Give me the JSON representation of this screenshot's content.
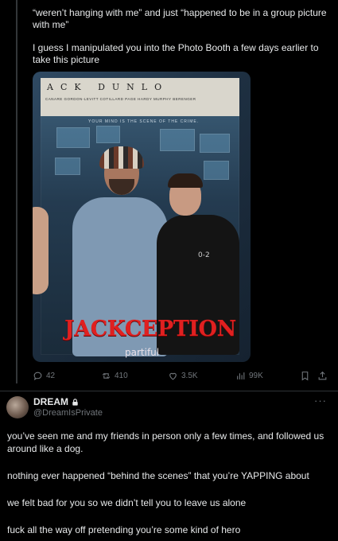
{
  "tweet_top": {
    "paragraph1": "“weren’t hanging with me” and just “happened to be in a group picture with me”",
    "paragraph2": "I guess I manipulated you into the Photo Booth a few days earlier to take this picture"
  },
  "photo": {
    "poster_title": "ACK DUNLO",
    "poster_cast": "CANARE GORDON-LEVITT COTILLARD PAGE HARDY MURPHY BERENGER",
    "poster_tagline": "YOUR MIND IS THE SCENE OF THE CRIME.",
    "shirt_text": "0-2",
    "headline": "JACKCEPTION",
    "watermark": "partiful"
  },
  "actions": {
    "replies": "42",
    "reposts": "410",
    "likes": "3.5K",
    "views": "99K"
  },
  "reply": {
    "name": "DREAM",
    "handle": "@DreamIsPrivate",
    "more": "···",
    "paragraphs": [
      "you’ve seen me and my friends in person only a few times, and followed us around like a dog.",
      "nothing ever happened “behind the scenes” that you’re YAPPING about",
      "we felt bad for you so we didn’t tell you to leave us alone",
      "fuck all the way off pretending you’re some kind of hero"
    ]
  },
  "icons": {
    "reply": "reply-icon",
    "repost": "repost-icon",
    "like": "heart-icon",
    "views": "views-icon",
    "bookmark": "bookmark-icon",
    "share": "share-icon",
    "lock": "lock-icon"
  },
  "colors": {
    "background": "#000000",
    "text": "#e7e9ea",
    "muted": "#71767b",
    "divider": "#2f3336",
    "headline_red": "#e02020"
  }
}
